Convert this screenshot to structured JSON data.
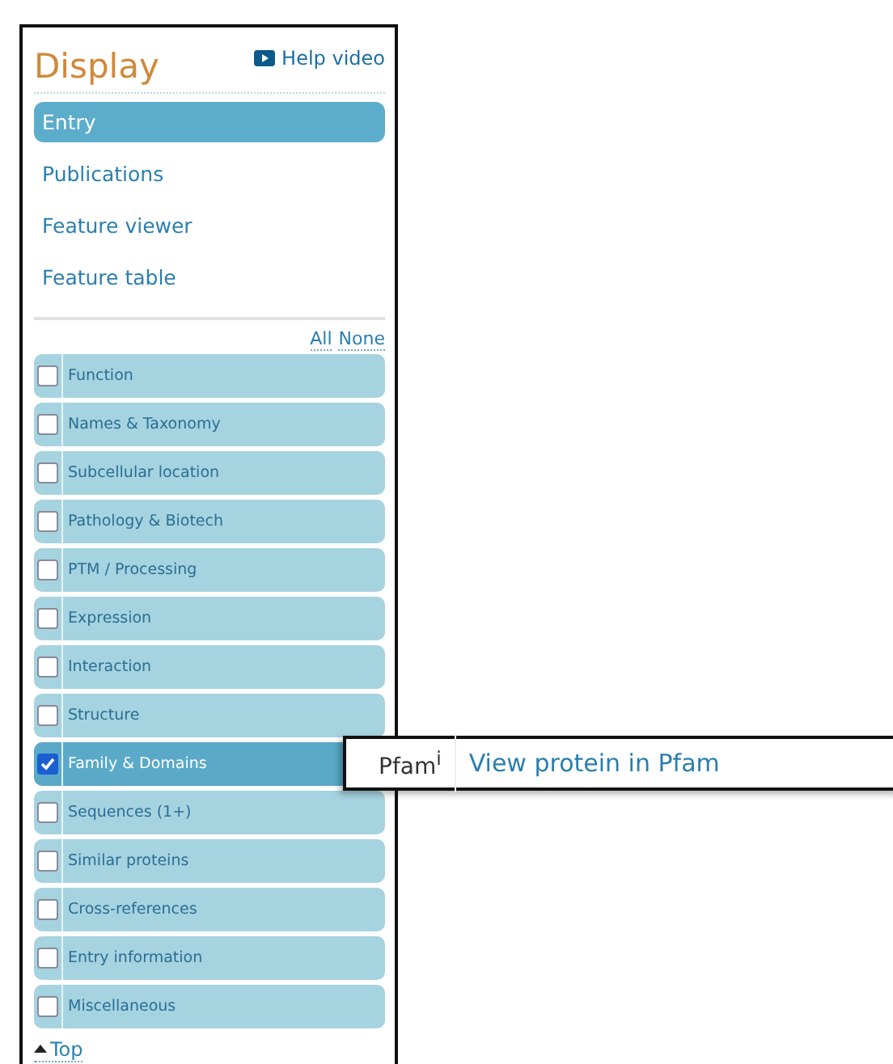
{
  "header": {
    "title": "Display",
    "help_link": "Help video"
  },
  "nav": [
    {
      "label": "Entry",
      "selected": true
    },
    {
      "label": "Publications",
      "selected": false
    },
    {
      "label": "Feature viewer",
      "selected": false
    },
    {
      "label": "Feature table",
      "selected": false
    }
  ],
  "select_links": [
    "All",
    "None"
  ],
  "sections": [
    {
      "label": "Function",
      "checked": false
    },
    {
      "label": "Names & Taxonomy",
      "checked": false
    },
    {
      "label": "Subcellular location",
      "checked": false
    },
    {
      "label": "Pathology & Biotech",
      "checked": false
    },
    {
      "label": "PTM / Processing",
      "checked": false
    },
    {
      "label": "Expression",
      "checked": false
    },
    {
      "label": "Interaction",
      "checked": false
    },
    {
      "label": "Structure",
      "checked": false
    },
    {
      "label": "Family & Domains",
      "checked": true
    },
    {
      "label": "Sequences (1+)",
      "checked": false
    },
    {
      "label": "Similar proteins",
      "checked": false
    },
    {
      "label": "Cross-references",
      "checked": false
    },
    {
      "label": "Entry information",
      "checked": false
    },
    {
      "label": "Miscellaneous",
      "checked": false
    }
  ],
  "top_link": "Top",
  "popup": {
    "label": "Pfam$^{i}$",
    "link": "View protein in Pfam"
  }
}
